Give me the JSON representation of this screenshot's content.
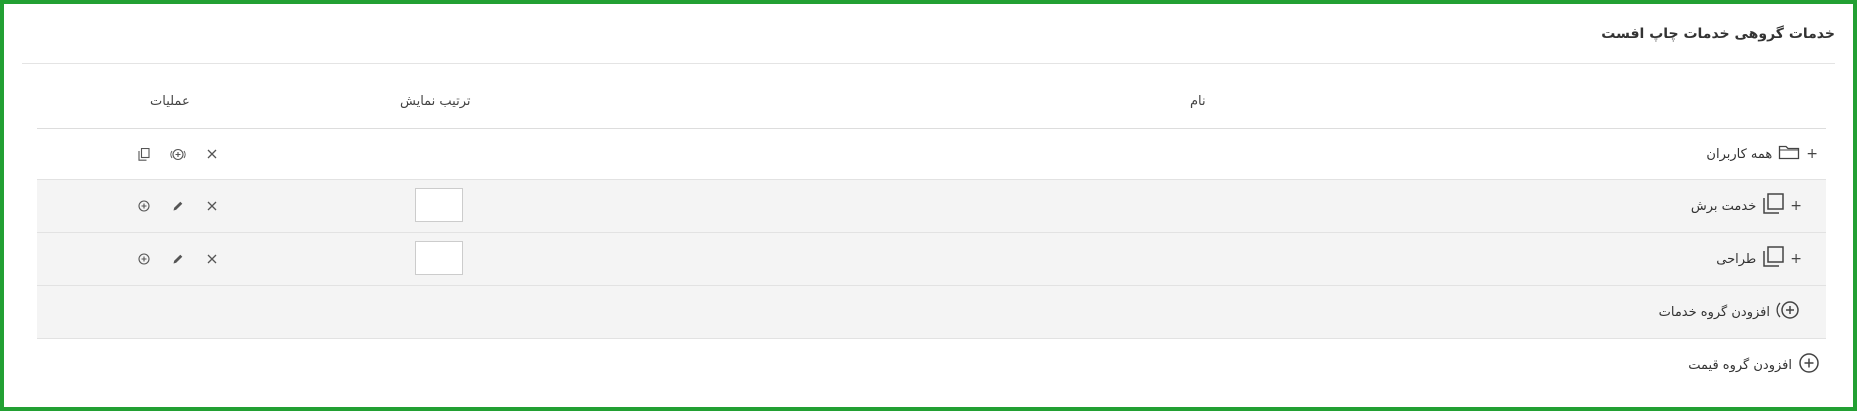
{
  "panel": {
    "title": "خدمات گروهی خدمات چاپ افست"
  },
  "table": {
    "headers": {
      "name": "نام",
      "order": "ترتیب نمایش",
      "operations": "عملیات"
    },
    "rows": [
      {
        "expand": "+",
        "icon": "folder-icon",
        "label": "همه کاربران"
      },
      {
        "expand": "+",
        "icon": "copy-icon",
        "label": "خدمت برش",
        "order": ""
      },
      {
        "expand": "+",
        "icon": "copy-icon",
        "label": "طراحی",
        "order": ""
      }
    ]
  },
  "actions": {
    "add_service_group": "افزودن گروه خدمات",
    "add_price_group": "افزودن گروه قیمت"
  },
  "colors": {
    "frame_border": "#22a033",
    "row_shade": "#f4f4f4"
  }
}
